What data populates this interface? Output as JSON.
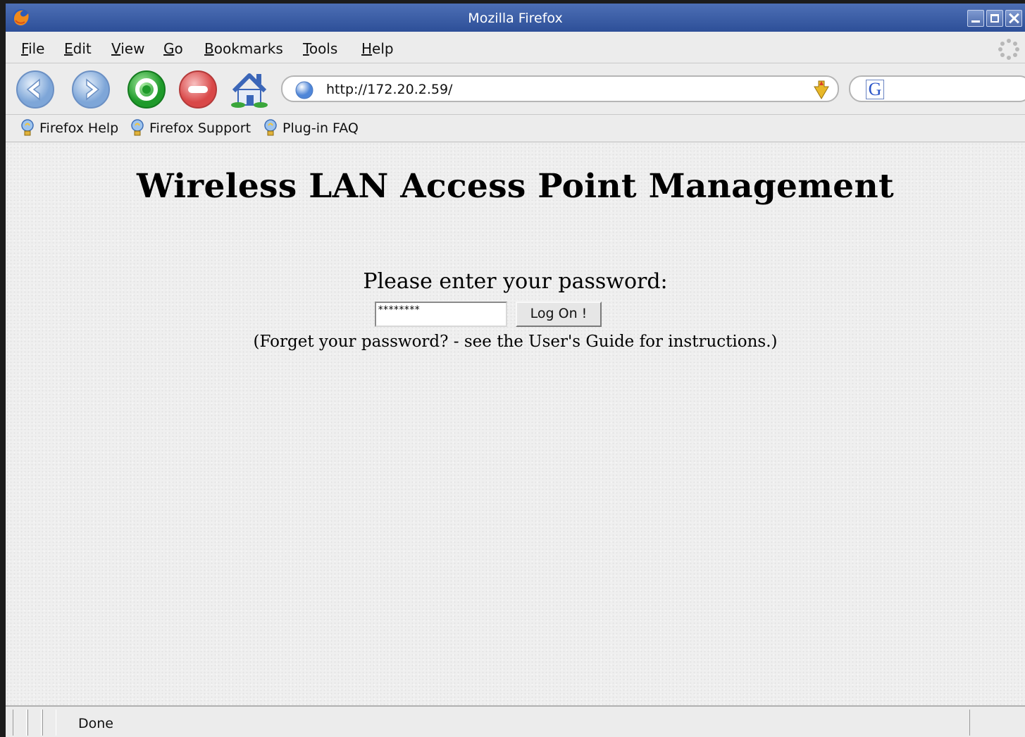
{
  "window": {
    "title": "Mozilla Firefox"
  },
  "menu": {
    "items": [
      {
        "underline": "F",
        "rest": "ile"
      },
      {
        "underline": "E",
        "rest": "dit"
      },
      {
        "underline": "V",
        "rest": "iew"
      },
      {
        "underline": "G",
        "rest": "o"
      },
      {
        "underline": "B",
        "rest": "ookmarks"
      },
      {
        "underline": "T",
        "rest": "ools"
      },
      {
        "underline": "H",
        "rest": "elp"
      }
    ]
  },
  "navigation": {
    "buttons": [
      "back-icon",
      "forward-icon",
      "reload-icon",
      "stop-icon",
      "home-icon"
    ],
    "url": "http://172.20.2.59/",
    "search_engine_icon": "G"
  },
  "bookmarks": {
    "items": [
      "Firefox Help",
      "Firefox Support",
      "Plug-in FAQ"
    ]
  },
  "page": {
    "heading": "Wireless LAN Access Point Management",
    "prompt": "Please enter your password:",
    "password_value": "********",
    "logon_label": "Log On !",
    "hint": "(Forget your password? - see the User's Guide for instructions.)"
  },
  "status": {
    "text": "Done"
  }
}
